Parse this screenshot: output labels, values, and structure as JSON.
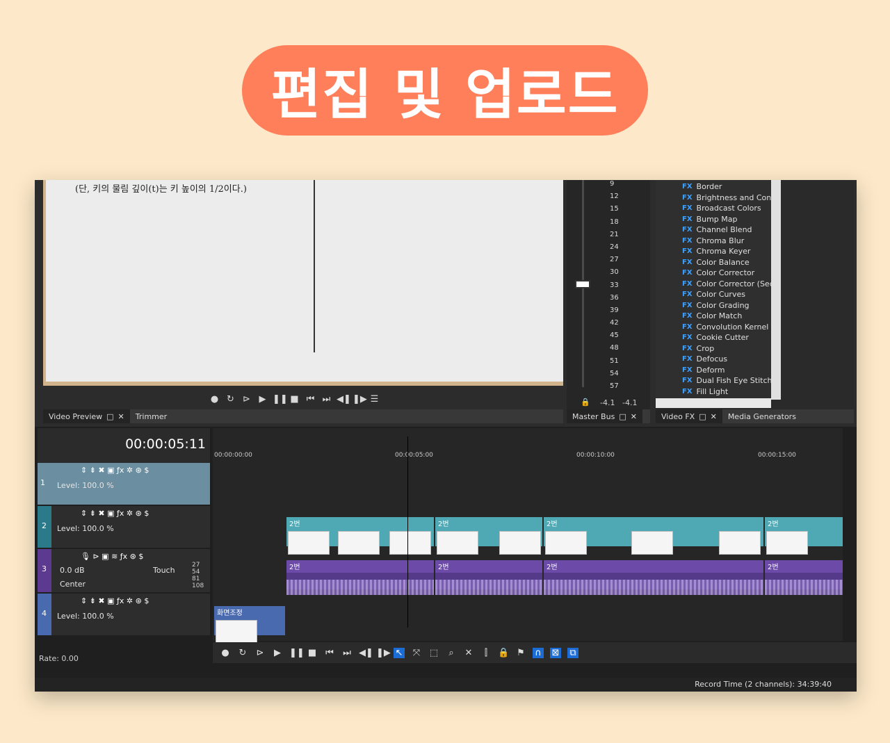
{
  "banner": {
    "title": "편집 및 업로드"
  },
  "preview": {
    "doc_text": "(단, 키의 물림 깊이(t)는 키 높이의 1/2이다.)",
    "tabs": [
      "Video Preview",
      "Trimmer"
    ],
    "transport": [
      "mic-icon",
      "loop-icon",
      "play-from-start-icon",
      "play-icon",
      "pause-icon",
      "stop-icon",
      "go-start-icon",
      "go-end-icon",
      "prev-frame-icon",
      "next-frame-icon",
      "menu-icon"
    ]
  },
  "master_bus": {
    "scale": [
      "9",
      "12",
      "15",
      "18",
      "21",
      "24",
      "27",
      "30",
      "33",
      "36",
      "39",
      "42",
      "45",
      "48",
      "51",
      "54",
      "57"
    ],
    "readout_left": "-4.1",
    "readout_right": "-4.1",
    "tab": "Master Bus"
  },
  "video_fx": {
    "items": [
      "Border",
      "Brightness and Contr",
      "Broadcast Colors",
      "Bump Map",
      "Channel Blend",
      "Chroma Blur",
      "Chroma Keyer",
      "Color Balance",
      "Color Corrector",
      "Color Corrector (Sec",
      "Color Curves",
      "Color Grading",
      "Color Match",
      "Convolution Kernel",
      "Cookie Cutter",
      "Crop",
      "Defocus",
      "Deform",
      "Dual Fish Eye Stitchi",
      "Fill Light"
    ],
    "fx_badge": "FX",
    "tabs": [
      "Video FX",
      "Media Generators"
    ]
  },
  "timeline": {
    "timecode": "00:00:05:11",
    "ruler": [
      "00:00:00:00",
      "00:00:05:00",
      "00:00:10:00",
      "00:00:15:00"
    ],
    "tracks": [
      {
        "num": "1",
        "level": "Level: 100.0 %"
      },
      {
        "num": "2",
        "level": "Level: 100.0 %"
      },
      {
        "num": "3",
        "db": "0.0 dB",
        "pan": "Center",
        "mode": "Touch"
      },
      {
        "num": "4",
        "level": "Level: 100.0 %"
      }
    ],
    "meter_nums": [
      "27",
      "54",
      "81",
      "108"
    ],
    "clip_label": "2번",
    "small_clip_label": "화면조정",
    "rate": "Rate: 0.00"
  },
  "status": {
    "record_time": "Record Time (2 channels): 34:39:40"
  }
}
